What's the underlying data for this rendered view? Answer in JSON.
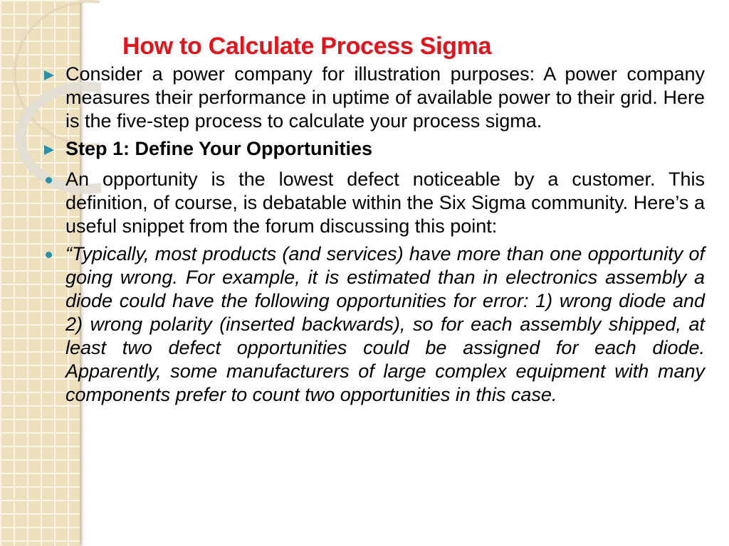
{
  "slide": {
    "title": "How to Calculate Process Sigma",
    "items": [
      {
        "type": "arrow",
        "text": "Consider a power company for illustration purposes: A power company measures their performance in uptime of available power to their grid. Here is the five-step process to calculate your process sigma."
      },
      {
        "type": "arrow",
        "text": "Step 1: Define Your Opportunities"
      },
      {
        "type": "dot",
        "text": "An opportunity is the lowest defect noticeable by a customer. This definition, of course, is debatable within the Six Sigma community. Here’s a useful snippet from the forum discussing this point:"
      },
      {
        "type": "dot",
        "text": "“Typically, most products (and services) have more than one opportunity of going wrong. For example, it is estimated than in electronics assembly a diode could have the following opportunities for error: 1) wrong diode and 2) wrong polarity (inserted backwards), so for each assembly shipped, at least two defect opportunities could be assigned for each diode. Apparently, some manufacturers of large complex equipment with many components prefer to count two opportunities in this case."
      }
    ]
  },
  "colors": {
    "title": "#e8121b",
    "bullet": "#2a8fa8",
    "strip": "#efe0bd"
  }
}
